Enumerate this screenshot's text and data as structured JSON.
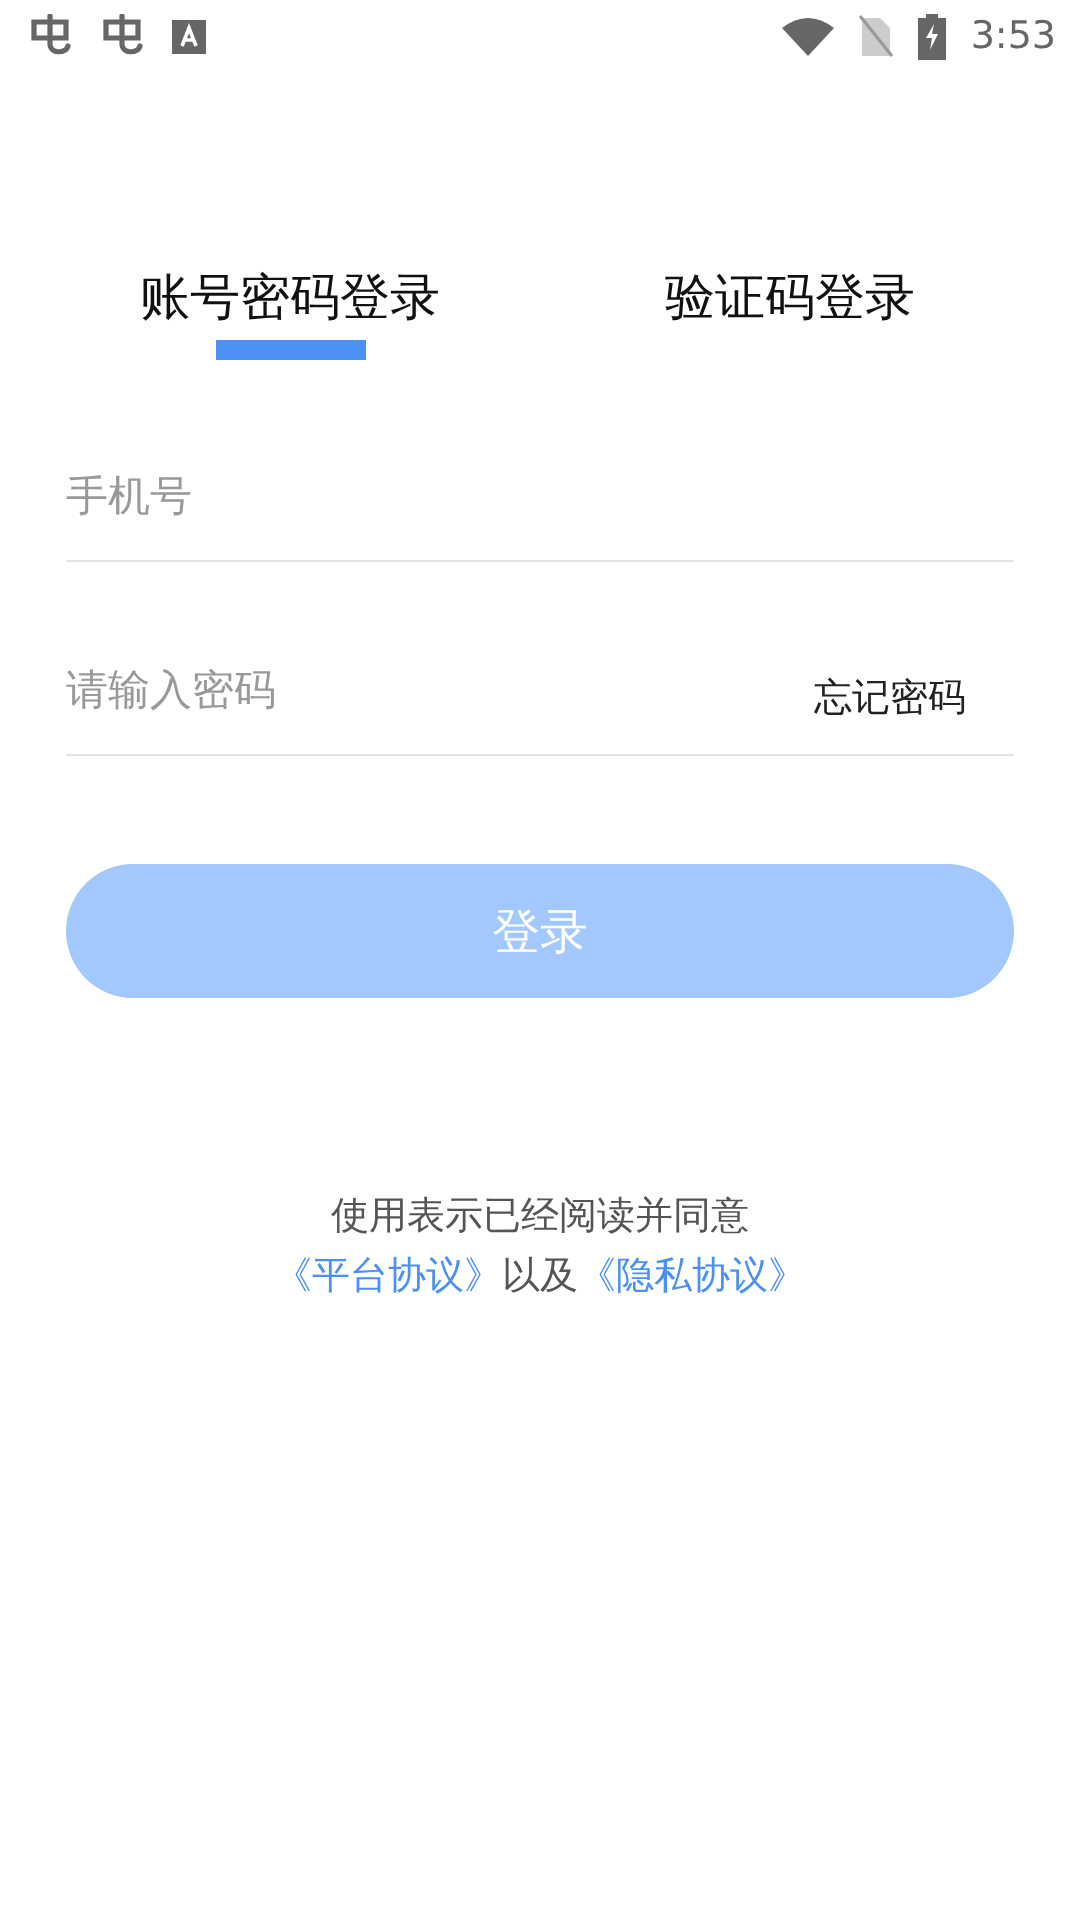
{
  "status_bar": {
    "time": "3:53"
  },
  "tabs": [
    {
      "label": "账号密码登录",
      "selected": true
    },
    {
      "label": "验证码登录",
      "selected": false
    }
  ],
  "phone_field": {
    "placeholder": "手机号"
  },
  "password_field": {
    "placeholder": "请输入密码",
    "link": "忘记密码"
  },
  "login_button": {
    "label": "登录",
    "disabled": true
  },
  "agreement": {
    "line": "使用表示已经阅读并同意",
    "links": [
      "《平台协议》",
      "《隐私协议》"
    ],
    "joiner": "以及"
  }
}
